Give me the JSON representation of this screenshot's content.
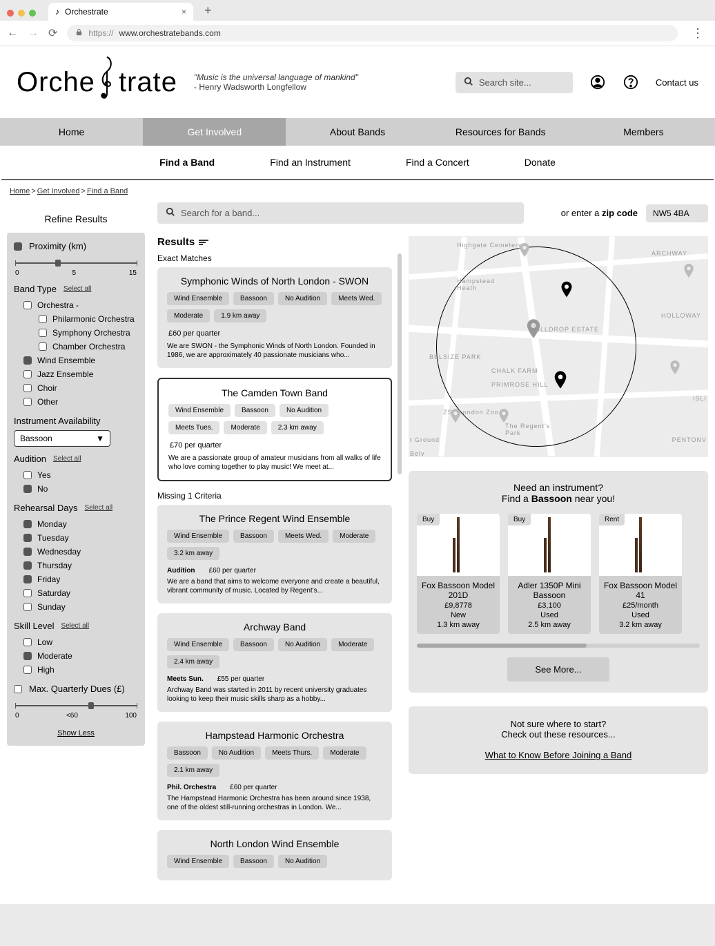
{
  "browser": {
    "tab_title": "Orchestrate",
    "url_prefix": "https://",
    "url": "www.orchestratebands.com"
  },
  "header": {
    "logo_left": "Orche",
    "logo_right": "trate",
    "quote": "\"Music is the universal language of mankind\"",
    "quote_author": "- Henry Wadsworth Longfellow",
    "search_placeholder": "Search site...",
    "contact": "Contact us"
  },
  "nav": {
    "main": [
      "Home",
      "Get Involved",
      "About Bands",
      "Resources for Bands",
      "Members"
    ],
    "main_active": 1,
    "sub": [
      "Find a Band",
      "Find an Instrument",
      "Find a Concert",
      "Donate"
    ],
    "sub_active": 0
  },
  "breadcrumbs": [
    "Home",
    "Get Involved",
    "Find a Band"
  ],
  "search": {
    "band_placeholder": "Search for a band...",
    "or_text": "or enter a ",
    "zip_label": "zip code",
    "zip_value": "NW5 4BA"
  },
  "filters": {
    "title": "Refine Results",
    "select_all": "Select all",
    "proximity": {
      "label": "Proximity (km)",
      "min": "0",
      "mid": "5",
      "max": "15"
    },
    "band_type": {
      "label": "Band Type",
      "items": [
        {
          "label": "Orchestra -",
          "checked": false,
          "sub": [
            {
              "label": "Philarmonic Orchestra",
              "checked": false
            },
            {
              "label": "Symphony Orchestra",
              "checked": false
            },
            {
              "label": "Chamber Orchestra",
              "checked": false
            }
          ]
        },
        {
          "label": "Wind Ensemble",
          "checked": true
        },
        {
          "label": "Jazz Ensemble",
          "checked": false
        },
        {
          "label": "Choir",
          "checked": false
        },
        {
          "label": "Other",
          "checked": false
        }
      ]
    },
    "instrument": {
      "label": "Instrument Availability",
      "value": "Bassoon"
    },
    "audition": {
      "label": "Audition",
      "items": [
        {
          "label": "Yes",
          "checked": false
        },
        {
          "label": "No",
          "checked": true
        }
      ]
    },
    "rehearsal": {
      "label": "Rehearsal Days",
      "items": [
        {
          "label": "Monday",
          "checked": true
        },
        {
          "label": "Tuesday",
          "checked": true
        },
        {
          "label": "Wednesday",
          "checked": true
        },
        {
          "label": "Thursday",
          "checked": true
        },
        {
          "label": "Friday",
          "checked": true
        },
        {
          "label": "Saturday",
          "checked": false
        },
        {
          "label": "Sunday",
          "checked": false
        }
      ]
    },
    "skill": {
      "label": "Skill Level",
      "items": [
        {
          "label": "Low",
          "checked": false
        },
        {
          "label": "Moderate",
          "checked": true
        },
        {
          "label": "High",
          "checked": false
        }
      ]
    },
    "dues": {
      "label": "Max. Quarterly Dues (£)",
      "min": "0",
      "mid": "<60",
      "max": "100"
    },
    "show_less": "Show Less"
  },
  "results": {
    "header": "Results",
    "exact_label": "Exact Matches",
    "missing_label": "Missing 1 Criteria",
    "exact": [
      {
        "title": "Symphonic Winds of North London - SWON",
        "tags": [
          "Wind Ensemble",
          "Bassoon",
          "No Audition",
          "Meets Wed.",
          "Moderate",
          "1.9 km away"
        ],
        "price": "£60 per quarter",
        "desc": "We are SWON - the Symphonic Winds of North London. Founded in 1986, we are approximately 40 passionate musicians who...",
        "selected": false
      },
      {
        "title": "The Camden Town Band",
        "tags": [
          "Wind Ensemble",
          "Bassoon",
          "No Audition",
          "Meets Tues.",
          "Moderate",
          "2.3 km away"
        ],
        "price": "£70 per quarter",
        "desc": "We are a passionate group of amateur musicians from all walks of life who love coming together to play music! We meet at...",
        "selected": true
      }
    ],
    "missing": [
      {
        "title": "The Prince Regent Wind Ensemble",
        "tags": [
          "Wind Ensemble",
          "Bassoon",
          "Meets Wed.",
          "Moderate",
          "3.2 km away"
        ],
        "bold": "Audition",
        "plain": "£60 per quarter",
        "desc": "We are a band that aims to welcome everyone and create a beautiful, vibrant community of music. Located by Regent's..."
      },
      {
        "title": "Archway Band",
        "tags": [
          "Wind Ensemble",
          "Bassoon",
          "No Audition",
          "Moderate",
          "2.4 km away"
        ],
        "bold": "Meets Sun.",
        "plain": "£55 per quarter",
        "desc": "Archway Band was started in 2011 by recent university graduates looking to keep their music skills sharp as a hobby..."
      },
      {
        "title": "Hampstead Harmonic Orchestra",
        "tags": [
          "Bassoon",
          "No Audition",
          "Meets Thurs.",
          "Moderate",
          "2.1 km away"
        ],
        "bold": "Phil. Orchestra",
        "plain": "£60 per quarter",
        "desc": "The Hampstead Harmonic Orchestra has been around since 1938, one of the oldest still-running orchestras in London. We..."
      },
      {
        "title": "North London Wind Ensemble",
        "tags": [
          "Wind Ensemble",
          "Bassoon",
          "No Audition"
        ],
        "bold": "",
        "plain": "",
        "desc": ""
      }
    ]
  },
  "map_labels": {
    "highgate": "Highgate Cemetery",
    "archway": "ARCHWAY",
    "hampstead": "Hampstead\nHeath",
    "hilldrop": "HILLDROP ESTATE",
    "holloway": "HOLLOWAY",
    "belsize": "BELSIZE PARK",
    "chalk": "CHALK FARM",
    "primrose": "PRIMROSE HILL",
    "zoo": "ZSL London Zoo",
    "regents": "The Regent's\nPark",
    "isl": "ISLI",
    "pentonv": "PENTONV",
    "ground": "t Ground",
    "belv": "Belv"
  },
  "instruments": {
    "heading1": "Need an instrument?",
    "heading2a": "Find a ",
    "heading2b": "Bassoon",
    "heading2c": " near you!",
    "see_more": "See More...",
    "cards": [
      {
        "badge": "Buy",
        "name": "Fox Bassoon Model 201D",
        "price": "£9,8778",
        "cond": "New",
        "dist": "1.3 km away"
      },
      {
        "badge": "Buy",
        "name": "Adler 1350P Mini Bassoon",
        "price": "£3,100",
        "cond": "Used",
        "dist": "2.5 km away"
      },
      {
        "badge": "Rent",
        "name": "Fox Bassoon Model 41",
        "price": "£25/month",
        "cond": "Used",
        "dist": "3.2 km away"
      }
    ]
  },
  "resources": {
    "line1": "Not sure where to start?",
    "line2": "Check out these resources...",
    "link": "What to Know Before Joining a Band"
  }
}
